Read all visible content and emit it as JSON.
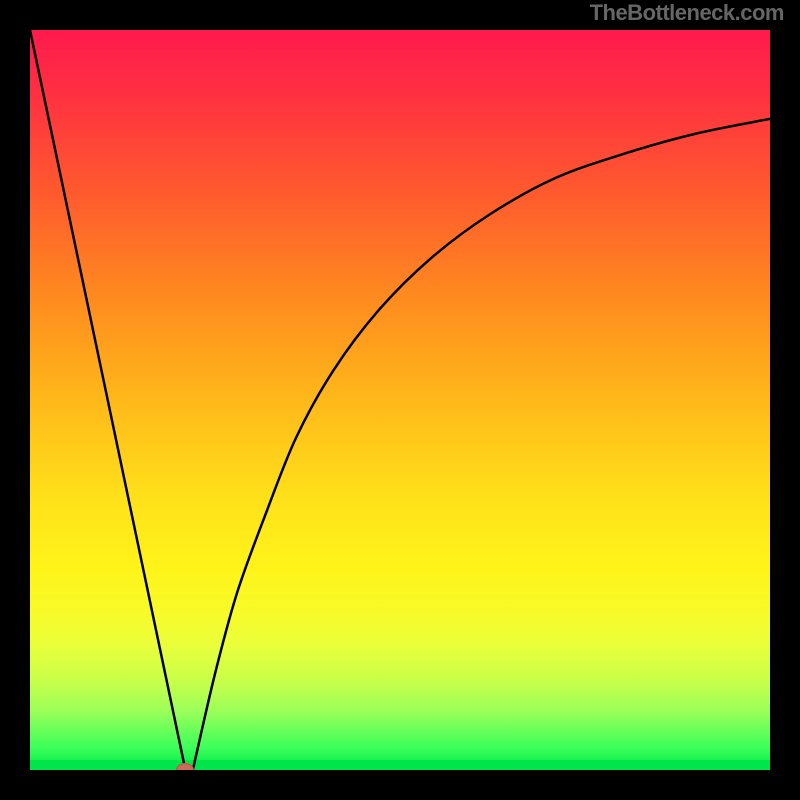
{
  "watermark": "TheBottleneck.com",
  "chart_data": {
    "type": "line",
    "title": "",
    "xlabel": "",
    "ylabel": "",
    "xlim": [
      0,
      100
    ],
    "ylim": [
      0,
      100
    ],
    "grid": false,
    "legend": false,
    "series": [
      {
        "name": "left-slope",
        "x": [
          0,
          21
        ],
        "y": [
          100,
          0
        ]
      },
      {
        "name": "right-curve",
        "x": [
          22,
          25,
          28,
          32,
          36,
          41,
          47,
          54,
          62,
          71,
          81,
          90,
          100
        ],
        "y": [
          0,
          13,
          24,
          35,
          45,
          54,
          62,
          69,
          75,
          80,
          83.5,
          86,
          88
        ]
      }
    ],
    "marker": {
      "x": 21,
      "y": 0,
      "color": "#c96a5a"
    },
    "gradient": {
      "top": "#ff1a4d",
      "mid_upper": "#ff8a1f",
      "mid": "#ffe01a",
      "mid_lower": "#eaff3a",
      "bottom": "#00e84a"
    }
  }
}
